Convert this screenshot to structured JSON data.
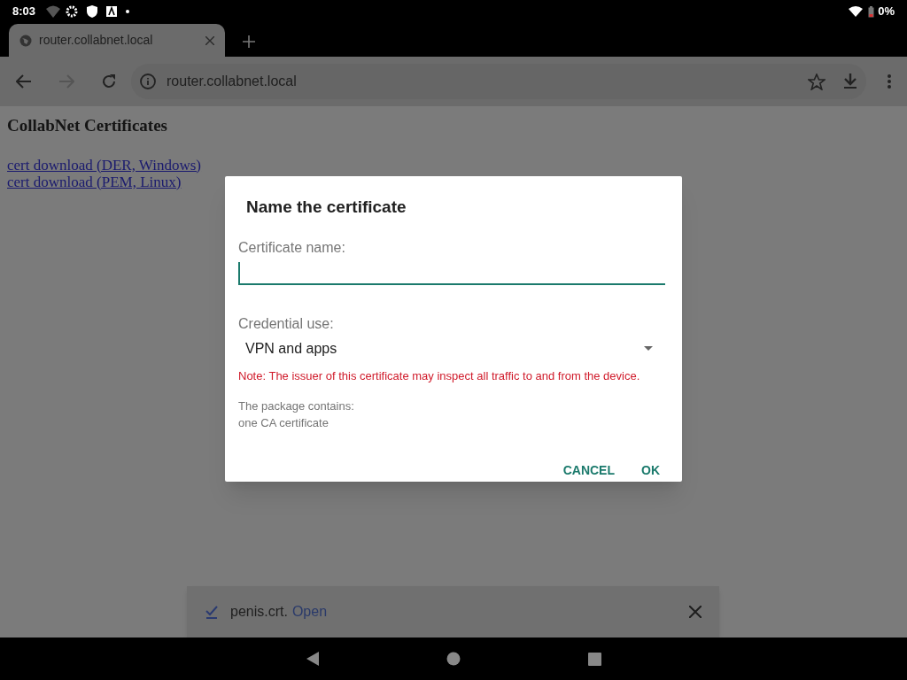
{
  "status_bar": {
    "time": "8:03",
    "battery": "0%"
  },
  "browser_tab": {
    "title": "router.collabnet.local"
  },
  "address_bar": {
    "url": "router.collabnet.local"
  },
  "page": {
    "heading": "CollabNet Certificates",
    "links": [
      "cert download (DER, Windows)",
      "cert download (PEM, Linux)"
    ]
  },
  "dialog": {
    "title": "Name the certificate",
    "name_label": "Certificate name:",
    "use_label": "Credential use:",
    "use_value": "VPN and apps",
    "note": "Note: The issuer of this certificate may inspect all traffic to and from the device.",
    "package_lines": [
      "The package contains:",
      "one CA certificate"
    ],
    "buttons": [
      "CANCEL",
      "OK"
    ]
  },
  "download_bar": {
    "filename": "penis.crt.",
    "action": "Open"
  }
}
